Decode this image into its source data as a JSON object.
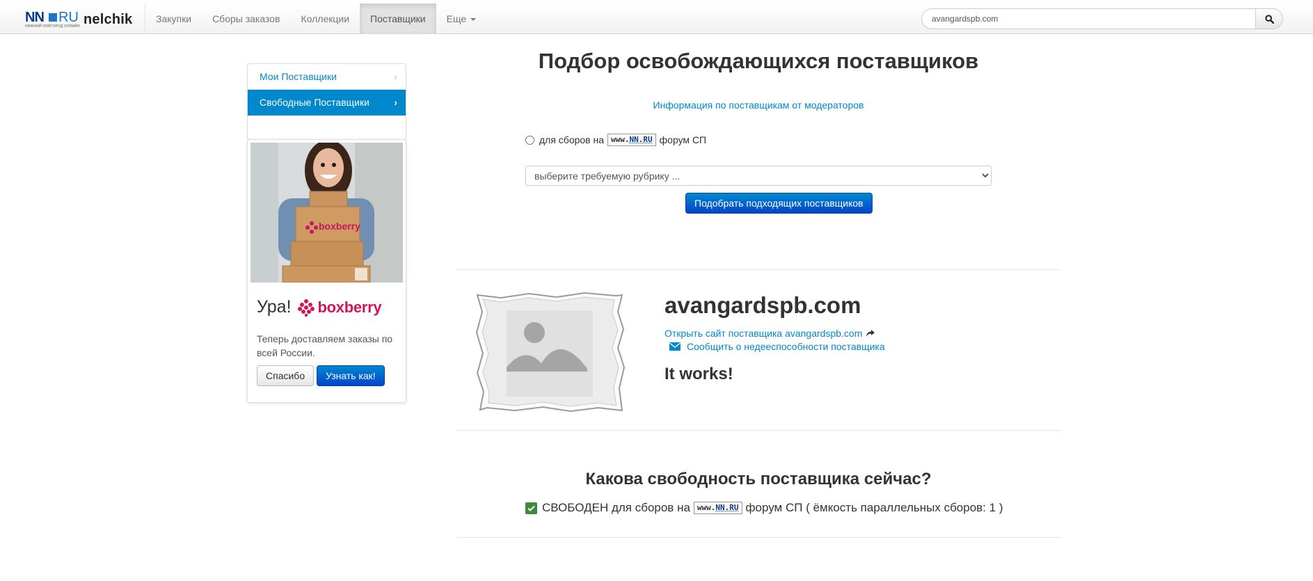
{
  "nav": {
    "logo_nn": "NN",
    "logo_ru": "RU",
    "logo_tagline": "НИЖНИЙ НОВГОРОД ОНЛАЙН",
    "brand": "nelchik",
    "items": [
      {
        "label": "Закупки",
        "active": false
      },
      {
        "label": "Сборы заказов",
        "active": false
      },
      {
        "label": "Коллекции",
        "active": false
      },
      {
        "label": "Поставщики",
        "active": true
      },
      {
        "label": "Еще",
        "active": false
      }
    ],
    "search_value": "avangardspb.com"
  },
  "sidebar": {
    "items": [
      {
        "label": "Мои Поставщики",
        "active": false
      },
      {
        "label": "Свободные Поставщики",
        "active": true
      }
    ]
  },
  "ad": {
    "headline": "Ура!",
    "brand": "boxberry",
    "text": "Теперь доставляем заказы по всей России.",
    "thanks_label": "Спасибо",
    "learn_label": "Узнать как!"
  },
  "main": {
    "title": "Подбор освобождающихся поставщиков",
    "info_link": "Информация по поставщикам от модераторов",
    "radio_prefix": "для сборов на",
    "badge_www": "www.",
    "badge_nn": "NN.RU",
    "radio_suffix": "форум СП",
    "select_placeholder": "выберите требуемую рубрику ...",
    "pick_button": "Подобрать подходящих поставщиков"
  },
  "supplier": {
    "name": "avangardspb.com",
    "open_link": "Открыть сайт поставщика avangardspb.com",
    "report_link": "Сообщить о недееспособности поставщика",
    "status_text": "It works!"
  },
  "freedom": {
    "title": "Какова свободность поставщика сейчас?",
    "status_prefix": "СВОБОДЕН для сборов на",
    "status_suffix": "форум СП ( ёмкость параллельных сборов: 1 )"
  },
  "colors": {
    "link": "#0088cc",
    "primary": "#0044cc",
    "success": "#3c8a3c",
    "boxberry": "#d4145a"
  }
}
